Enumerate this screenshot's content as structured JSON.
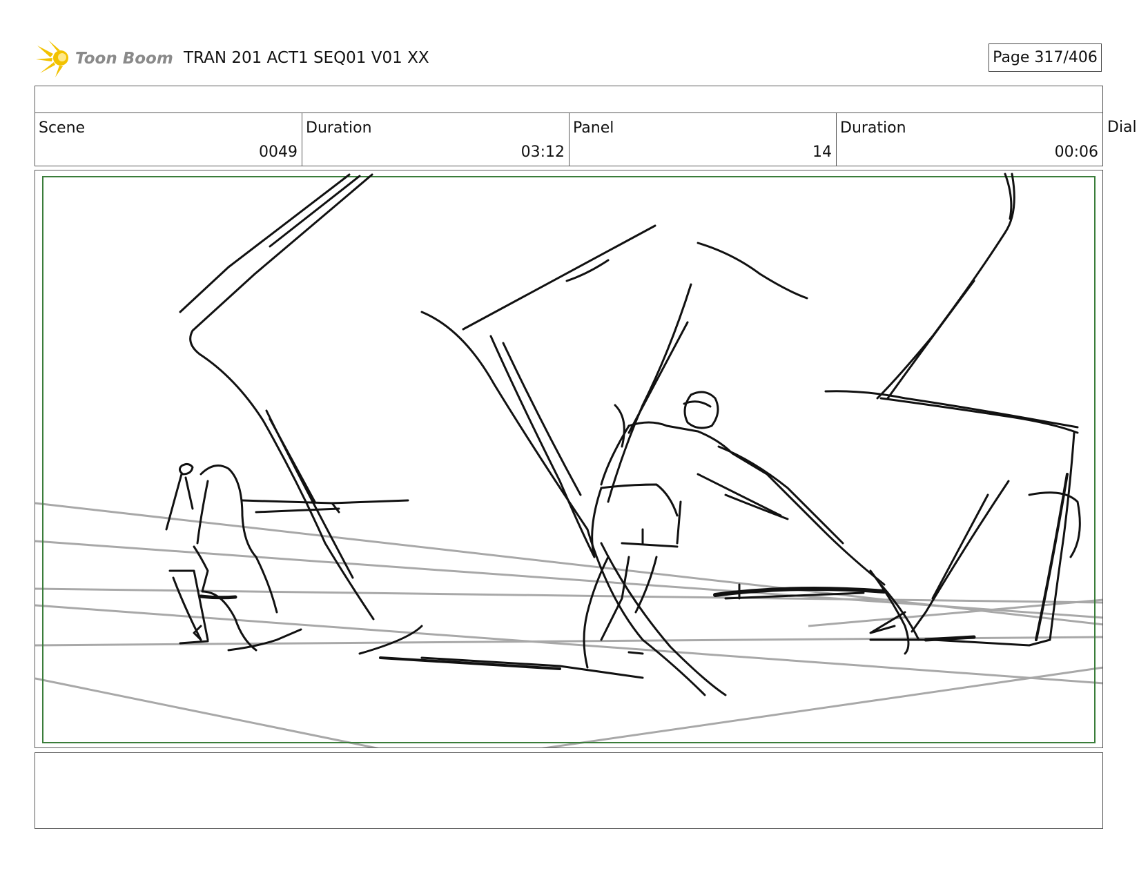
{
  "header": {
    "logo_text": "Toon Boom",
    "title": "TRAN 201 ACT1 SEQ01 V01 XX",
    "page": "Page 317/406"
  },
  "info": {
    "scene_label": "Scene",
    "scene_value": "0049",
    "scene_duration_label": "Duration",
    "scene_duration_value": "03:12",
    "panel_label": "Panel",
    "panel_value": "14",
    "panel_duration_label": "Duration",
    "panel_duration_value": "00:06",
    "cut_off_label": "Dial"
  },
  "colors": {
    "safe_frame": "#3a7d3a",
    "perspective_lines": "#a8a8a8",
    "sketch": "#111111",
    "logo_sun": "#f2c200",
    "logo_text": "#8a8a8a"
  }
}
